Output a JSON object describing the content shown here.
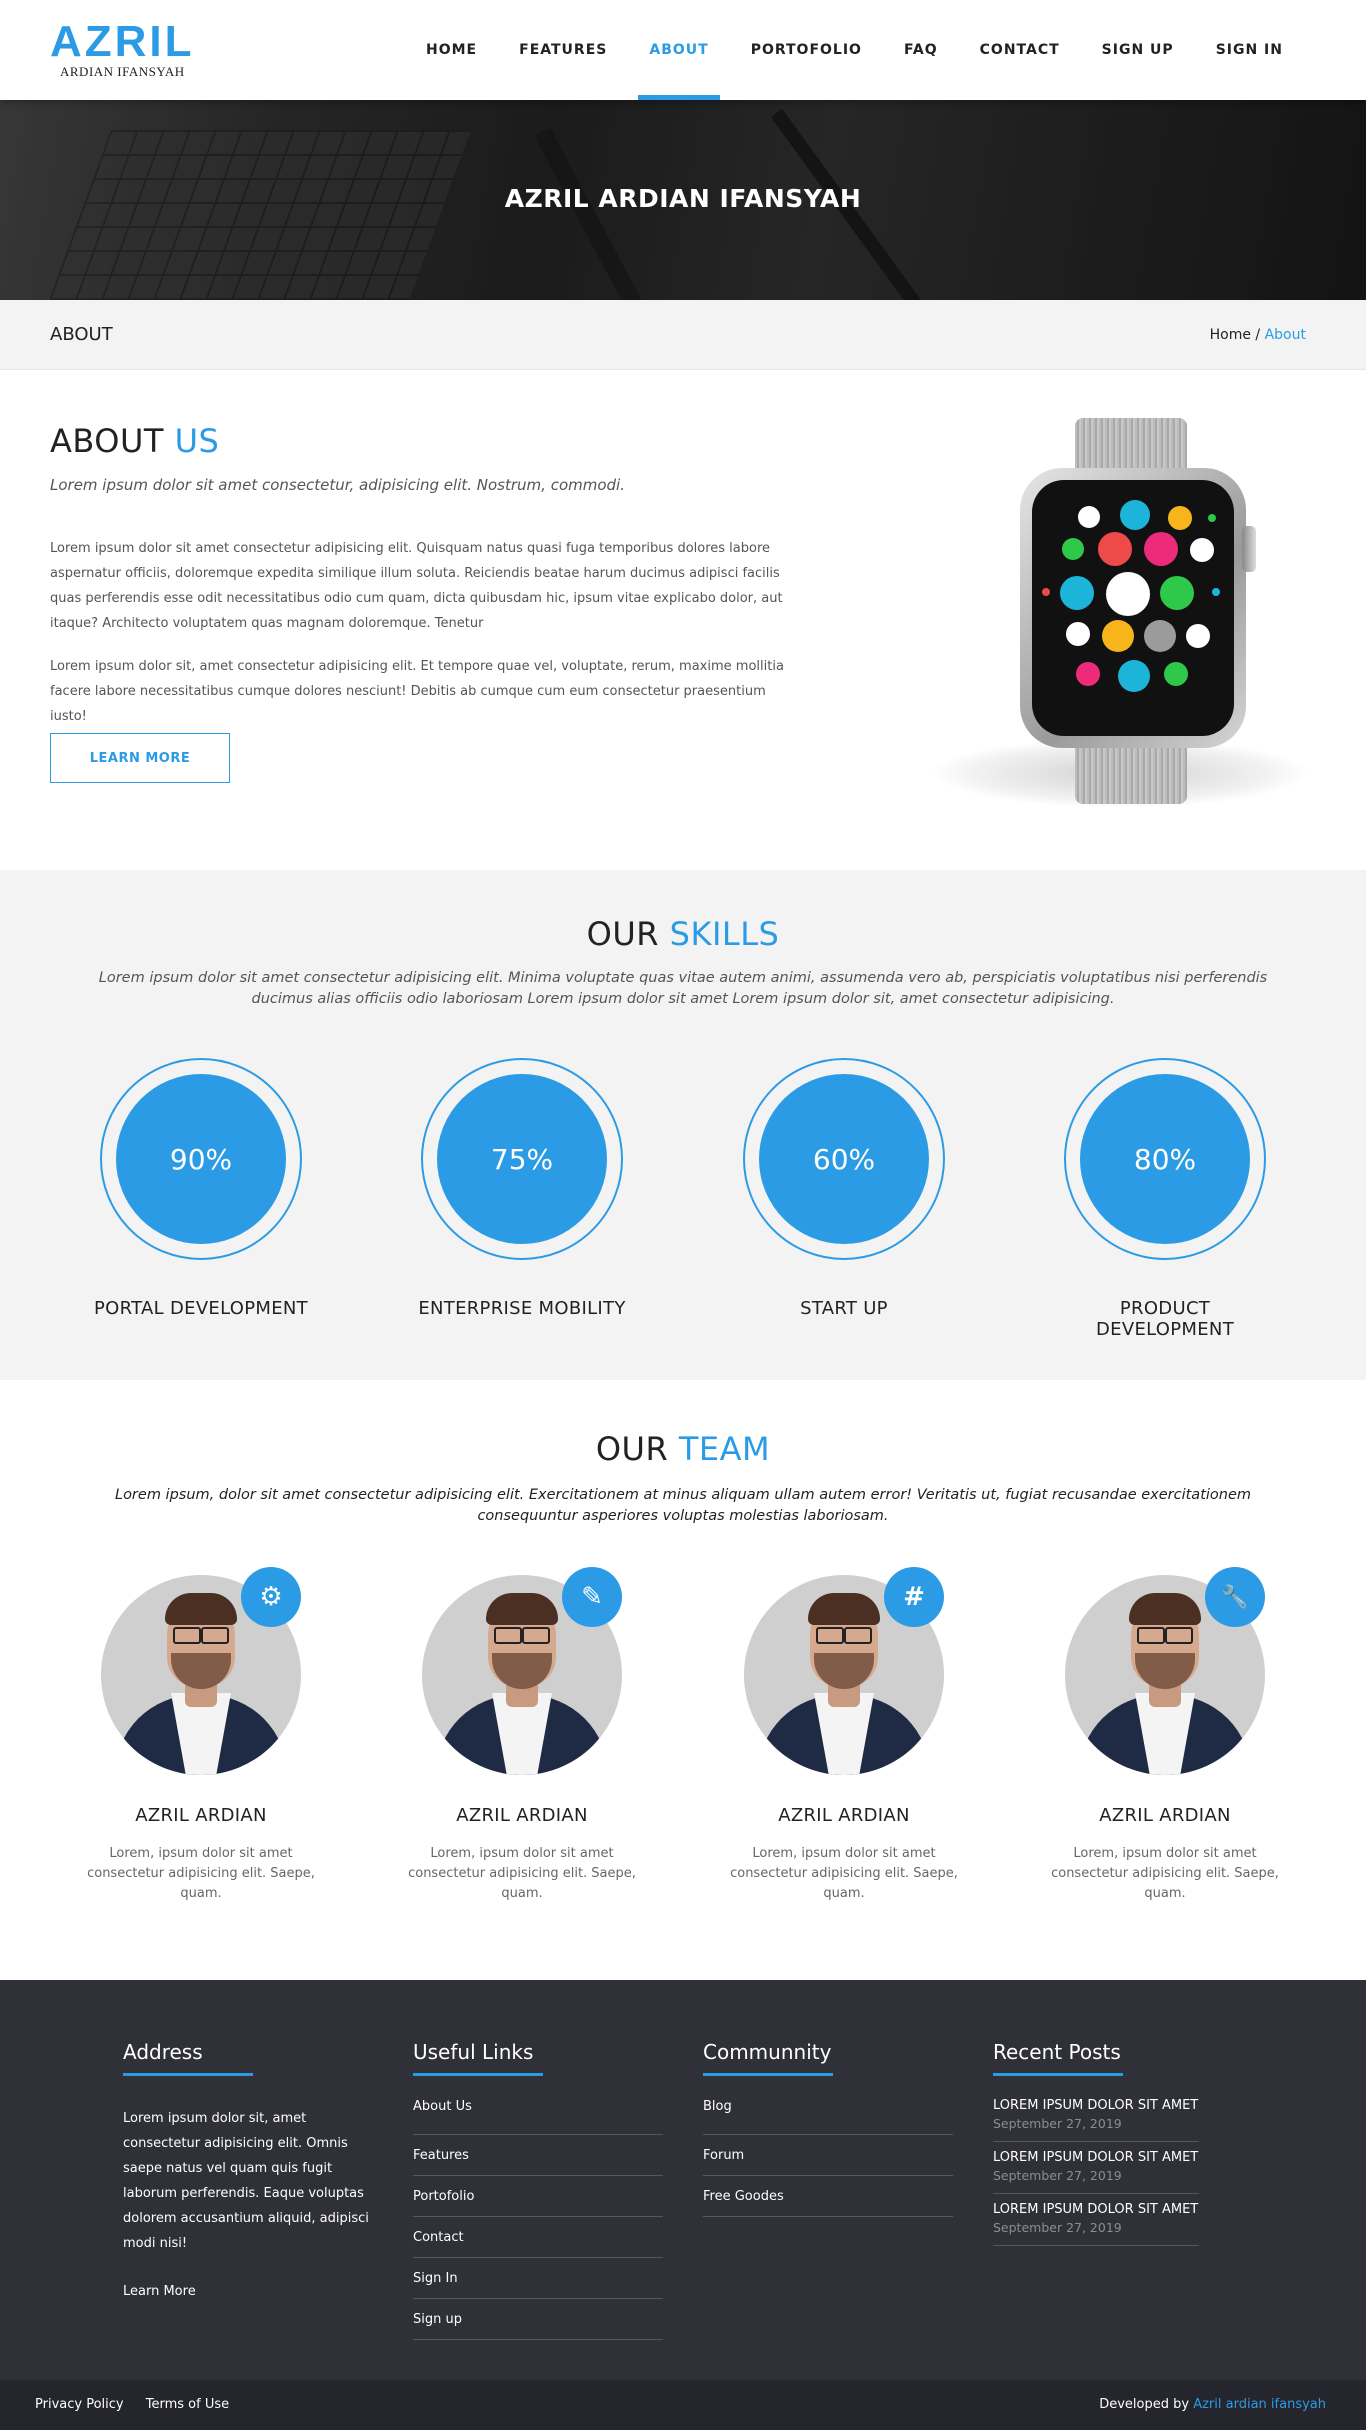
{
  "brand": {
    "name": "AZRIL",
    "subtitle": "ARDIAN IFANSYAH",
    "accent": "#2b9be5"
  },
  "nav": [
    "HOME",
    "FEATURES",
    "ABOUT",
    "PORTOFOLIO",
    "FAQ",
    "CONTACT",
    "SIGN UP",
    "SIGN IN"
  ],
  "nav_active": "ABOUT",
  "hero": {
    "title": "AZRIL ARDIAN IFANSYAH"
  },
  "crumbbar": {
    "title": "ABOUT",
    "home": "Home",
    "sep": "/",
    "current": "About"
  },
  "about": {
    "title_a": "ABOUT",
    "title_b": "US",
    "lead": "Lorem ipsum dolor sit amet consectetur, adipisicing elit. Nostrum, commodi.",
    "p1": "Lorem ipsum dolor sit amet consectetur adipisicing elit. Quisquam natus quasi fuga temporibus dolores labore aspernatur officiis, doloremque expedita similique illum soluta. Reiciendis beatae harum ducimus adipisci facilis quas perferendis esse odit necessitatibus odio cum quam, dicta quibusdam hic, ipsum vitae explicabo dolor, aut itaque? Architecto voluptatem quas magnam doloremque. Tenetur",
    "p2": "Lorem ipsum dolor sit, amet consectetur adipisicing elit. Et tempore quae vel, voluptate, rerum, maxime mollitia facere labore necessitatibus cumque dolores nesciunt! Debitis ab cumque cum eum consectetur praesentium iusto!",
    "button": "LEARN MORE"
  },
  "skills": {
    "title_a": "OUR",
    "title_b": "SKILLS",
    "desc": "Lorem ipsum dolor sit amet consectetur adipisicing elit. Minima voluptate quas vitae autem animi, assumenda vero ab, perspiciatis voluptatibus nisi perferendis ducimus alias officiis odio laboriosam Lorem ipsum dolor sit amet Lorem ipsum dolor sit, amet consectetur adipisicing.",
    "items": [
      {
        "value": "90%",
        "label": "PORTAL DEVELOPMENT"
      },
      {
        "value": "75%",
        "label": "ENTERPRISE MOBILITY"
      },
      {
        "value": "60%",
        "label": "START UP"
      },
      {
        "value": "80%",
        "label": "PRODUCT DEVELOPMENT"
      }
    ]
  },
  "team": {
    "title_a": "OUR",
    "title_b": "TEAM",
    "desc": "Lorem ipsum, dolor sit amet consectetur adipisicing elit. Exercitationem at minus aliquam ullam autem error! Veritatis ut, fugiat recusandae exercitationem consequuntur asperiores voluptas molestias laboriosam.",
    "members": [
      {
        "name": "AZRIL ARDIAN",
        "bio": "Lorem, ipsum dolor sit amet consectetur adipisicing elit. Saepe, quam.",
        "icon": "gear-icon",
        "glyph": "⚙"
      },
      {
        "name": "AZRIL ARDIAN",
        "bio": "Lorem, ipsum dolor sit amet consectetur adipisicing elit. Saepe, quam.",
        "icon": "pencil-icon",
        "glyph": "✎"
      },
      {
        "name": "AZRIL ARDIAN",
        "bio": "Lorem, ipsum dolor sit amet consectetur adipisicing elit. Saepe, quam.",
        "icon": "hashtag-icon",
        "glyph": "#"
      },
      {
        "name": "AZRIL ARDIAN",
        "bio": "Lorem, ipsum dolor sit amet consectetur adipisicing elit. Saepe, quam.",
        "icon": "wrench-icon",
        "glyph": "🔧"
      }
    ]
  },
  "footer": {
    "address": {
      "title": "Address",
      "text": "Lorem ipsum dolor sit, amet consectetur adipisicing elit. Omnis saepe natus vel quam quis fugit laborum perferendis. Eaque voluptas dolorem accusantium aliquid, adipisci modi nisi!",
      "link": "Learn More"
    },
    "useful": {
      "title": "Useful Links",
      "links": [
        "About Us",
        "Features",
        "Portofolio",
        "Contact",
        "Sign In",
        "Sign up"
      ]
    },
    "community": {
      "title": "Communnity",
      "links": [
        "Blog",
        "Forum",
        "Free Goodes"
      ]
    },
    "recent": {
      "title": "Recent Posts",
      "posts": [
        {
          "title": "LOREM IPSUM DOLOR SIT AMET",
          "date": "September 27, 2019"
        },
        {
          "title": "LOREM IPSUM DOLOR SIT AMET",
          "date": "September 27, 2019"
        },
        {
          "title": "LOREM IPSUM DOLOR SIT AMET",
          "date": "September 27, 2019"
        }
      ]
    }
  },
  "bottom": {
    "privacy": "Privacy Policy",
    "terms": "Terms of Use",
    "dev_prefix": "Developed by",
    "dev_name": "Azril ardian ifansyah"
  }
}
